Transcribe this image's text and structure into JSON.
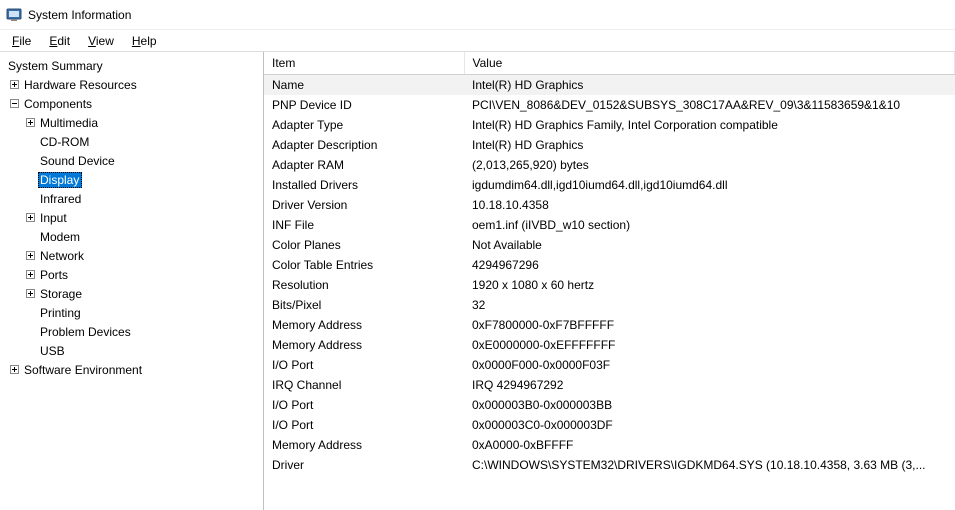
{
  "window": {
    "title": "System Information"
  },
  "menu": {
    "file": "File",
    "edit": "Edit",
    "view": "View",
    "help": "Help"
  },
  "tree": {
    "root": "System Summary",
    "hardware_resources": "Hardware Resources",
    "components": "Components",
    "multimedia": "Multimedia",
    "cdrom": "CD-ROM",
    "sound_device": "Sound Device",
    "display": "Display",
    "infrared": "Infrared",
    "input": "Input",
    "modem": "Modem",
    "network": "Network",
    "ports": "Ports",
    "storage": "Storage",
    "printing": "Printing",
    "problem_devices": "Problem Devices",
    "usb": "USB",
    "software_environment": "Software Environment"
  },
  "columns": {
    "item": "Item",
    "value": "Value"
  },
  "rows": [
    {
      "item": "Name",
      "value": "Intel(R) HD Graphics",
      "hl": true
    },
    {
      "item": "PNP Device ID",
      "value": "PCI\\VEN_8086&DEV_0152&SUBSYS_308C17AA&REV_09\\3&11583659&1&10"
    },
    {
      "item": "Adapter Type",
      "value": "Intel(R) HD Graphics Family, Intel Corporation compatible"
    },
    {
      "item": "Adapter Description",
      "value": "Intel(R) HD Graphics"
    },
    {
      "item": "Adapter RAM",
      "value": "(2,013,265,920) bytes"
    },
    {
      "item": "Installed Drivers",
      "value": "igdumdim64.dll,igd10iumd64.dll,igd10iumd64.dll"
    },
    {
      "item": "Driver Version",
      "value": "10.18.10.4358"
    },
    {
      "item": "INF File",
      "value": "oem1.inf (iIVBD_w10 section)"
    },
    {
      "item": "Color Planes",
      "value": "Not Available"
    },
    {
      "item": "Color Table Entries",
      "value": "4294967296"
    },
    {
      "item": "Resolution",
      "value": "1920 x 1080 x 60 hertz"
    },
    {
      "item": "Bits/Pixel",
      "value": "32"
    },
    {
      "item": "Memory Address",
      "value": "0xF7800000-0xF7BFFFFF"
    },
    {
      "item": "Memory Address",
      "value": "0xE0000000-0xEFFFFFFF"
    },
    {
      "item": "I/O Port",
      "value": "0x0000F000-0x0000F03F"
    },
    {
      "item": "IRQ Channel",
      "value": "IRQ 4294967292"
    },
    {
      "item": "I/O Port",
      "value": "0x000003B0-0x000003BB"
    },
    {
      "item": "I/O Port",
      "value": "0x000003C0-0x000003DF"
    },
    {
      "item": "Memory Address",
      "value": "0xA0000-0xBFFFF"
    },
    {
      "item": "Driver",
      "value": "C:\\WINDOWS\\SYSTEM32\\DRIVERS\\IGDKMD64.SYS (10.18.10.4358, 3.63 MB (3,..."
    }
  ]
}
